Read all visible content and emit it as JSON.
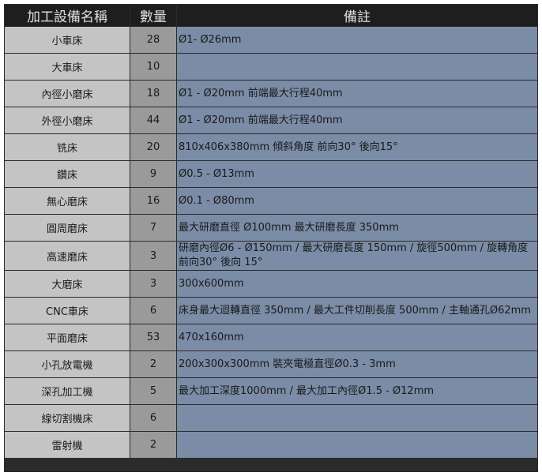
{
  "headers": {
    "name": "加工設備名稱",
    "count": "數量",
    "note": "備註"
  },
  "rows": [
    {
      "name": "小車床",
      "count": "28",
      "note": "Ø1- Ø26mm"
    },
    {
      "name": "大車床",
      "count": "10",
      "note": ""
    },
    {
      "name": "內徑小磨床",
      "count": "18",
      "note": "Ø1 - Ø20mm 前端最大行程40mm"
    },
    {
      "name": "外徑小磨床",
      "count": "44",
      "note": "Ø1 - Ø20mm 前端最大行程40mm"
    },
    {
      "name": "铣床",
      "count": "20",
      "note": "810x406x380mm 傾斜角度 前向30° 後向15°"
    },
    {
      "name": "鑽床",
      "count": "9",
      "note": "Ø0.5 - Ø13mm"
    },
    {
      "name": "無心磨床",
      "count": "16",
      "note": "Ø0.1 - Ø80mm"
    },
    {
      "name": "圓周磨床",
      "count": "7",
      "note": "最大研磨直徑 Ø100mm 最大研磨長度 350mm"
    },
    {
      "name": "高速磨床",
      "count": "3",
      "note": "研磨內徑Ø6 - Ø150mm / 最大研磨長度 150mm / 旋徑500mm / 旋轉角度 前向30° 後向 15°"
    },
    {
      "name": "大磨床",
      "count": "3",
      "note": "300x600mm"
    },
    {
      "name": "CNC車床",
      "count": "6",
      "note": "床身最大迴轉直徑 350mm / 最大工件切削長度 500mm / 主軸通孔Ø62mm"
    },
    {
      "name": "平面磨床",
      "count": "53",
      "note": "470x160mm"
    },
    {
      "name": "小孔放電機",
      "count": "2",
      "note": "200x300x300mm 裝夾電極直徑Ø0.3 - 3mm"
    },
    {
      "name": "深孔加工機",
      "count": "5",
      "note": "最大加工深度1000mm / 最大加工內徑Ø1.5 - Ø12mm"
    },
    {
      "name": "線切割機床",
      "count": "6",
      "note": ""
    },
    {
      "name": "雷射機",
      "count": "2",
      "note": ""
    }
  ]
}
